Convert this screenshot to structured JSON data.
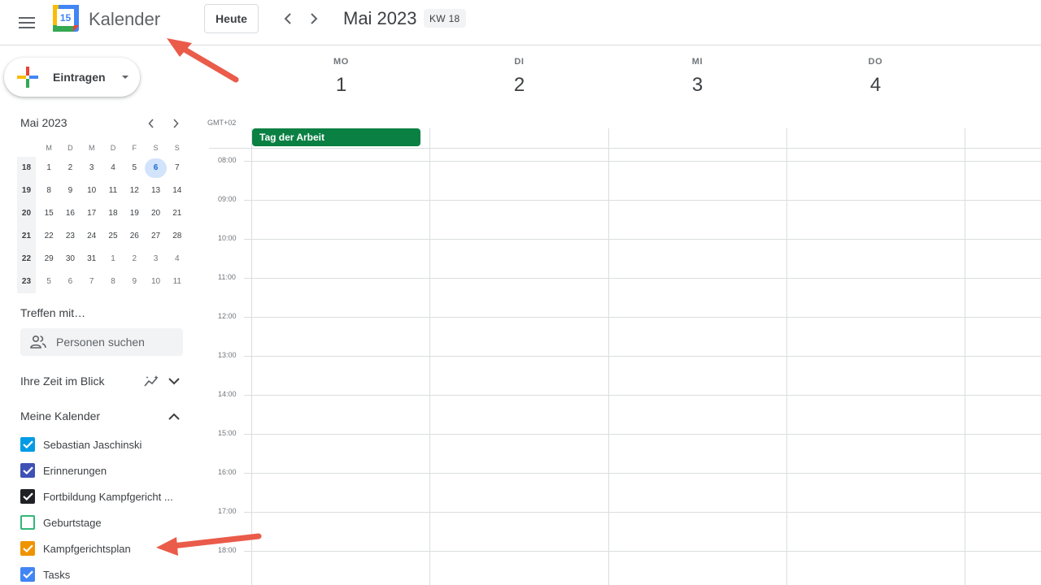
{
  "header": {
    "app_title": "Kalender",
    "logo_day": "15",
    "today_label": "Heute",
    "month_title": "Mai 2023",
    "week_badge": "KW 18"
  },
  "create": {
    "label": "Eintragen"
  },
  "mini_calendar": {
    "title": "Mai 2023",
    "weekday_headers": [
      "M",
      "D",
      "M",
      "D",
      "F",
      "S",
      "S"
    ],
    "weeks": [
      {
        "kw": "18",
        "days": [
          "1",
          "2",
          "3",
          "4",
          "5",
          "6",
          "7"
        ]
      },
      {
        "kw": "19",
        "days": [
          "8",
          "9",
          "10",
          "11",
          "12",
          "13",
          "14"
        ]
      },
      {
        "kw": "20",
        "days": [
          "15",
          "16",
          "17",
          "18",
          "19",
          "20",
          "21"
        ]
      },
      {
        "kw": "21",
        "days": [
          "22",
          "23",
          "24",
          "25",
          "26",
          "27",
          "28"
        ]
      },
      {
        "kw": "22",
        "days": [
          "29",
          "30",
          "31",
          "1",
          "2",
          "3",
          "4"
        ]
      },
      {
        "kw": "23",
        "days": [
          "5",
          "6",
          "7",
          "8",
          "9",
          "10",
          "11"
        ]
      }
    ],
    "today": "6"
  },
  "sidebar": {
    "meet_title": "Treffen mit…",
    "search_placeholder": "Personen suchen",
    "time_insights": "Ihre Zeit im Blick",
    "my_calendars_title": "Meine Kalender",
    "calendars": [
      {
        "label": "Sebastian Jaschinski",
        "color": "#039be5",
        "checked": true
      },
      {
        "label": "Erinnerungen",
        "color": "#3f51b5",
        "checked": true
      },
      {
        "label": "Fortbildung Kampfgericht ...",
        "color": "#202124",
        "checked": true
      },
      {
        "label": "Geburtstage",
        "color": "#33b679",
        "checked": false
      },
      {
        "label": "Kampfgerichtsplan",
        "color": "#f09300",
        "checked": true
      },
      {
        "label": "Tasks",
        "color": "#4285f4",
        "checked": true
      }
    ]
  },
  "week": {
    "timezone": "GMT+02",
    "days": [
      {
        "dow": "MO",
        "num": "1"
      },
      {
        "dow": "DI",
        "num": "2"
      },
      {
        "dow": "MI",
        "num": "3"
      },
      {
        "dow": "DO",
        "num": "4"
      }
    ],
    "times": [
      "08:00",
      "09:00",
      "10:00",
      "11:00",
      "12:00",
      "13:00",
      "14:00",
      "15:00",
      "16:00",
      "17:00",
      "18:00"
    ],
    "allday_event": {
      "title": "Tag der Arbeit",
      "color": "#0b8043"
    }
  },
  "colors": {
    "accent": "#1a73e8",
    "arrow": "#ea5b4a"
  }
}
